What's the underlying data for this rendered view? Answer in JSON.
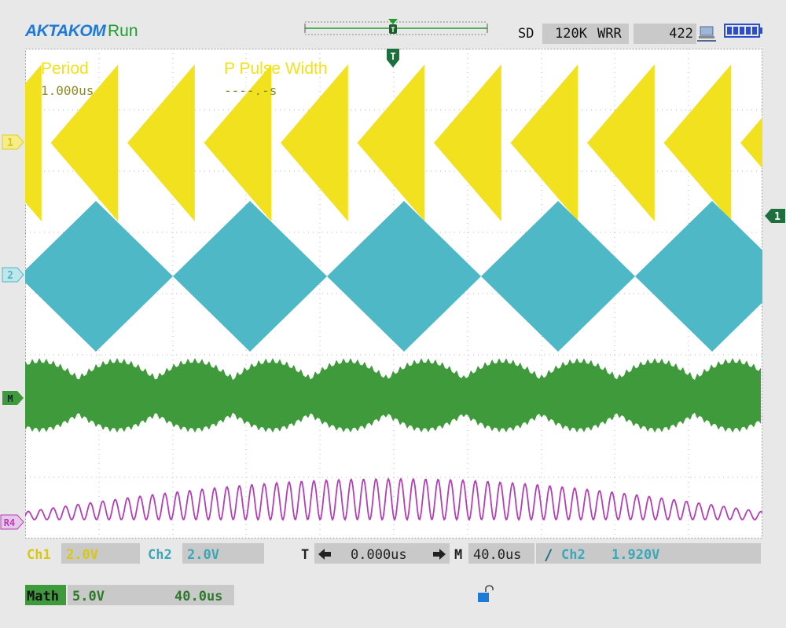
{
  "header": {
    "brand": "AKTAKOM",
    "run_state": "Run",
    "acq_mode": "SD",
    "memory_depth": "120K",
    "mode": "WRR",
    "acq_count": "422"
  },
  "icons": {
    "network": "network-icon",
    "battery": "battery-icon",
    "trigger_position": "trigger-t-icon",
    "lock": "lock-icon",
    "arrow_left": "arrow-left-icon",
    "arrow_right": "arrow-right-icon",
    "slope": "rising-edge-icon"
  },
  "markers": {
    "ch1": "1",
    "ch2": "2",
    "math": "M",
    "ref": "R4",
    "trigger_level": "1",
    "trigger": "T"
  },
  "measurements": [
    {
      "label": "Period",
      "value": "1.000us"
    },
    {
      "label": "P Pulse Width",
      "value": "----.-s"
    }
  ],
  "channels": {
    "ch1": {
      "label": "Ch1",
      "scale": "2.0V",
      "color": "#f1e11e"
    },
    "ch2": {
      "label": "Ch2",
      "scale": "2.0V",
      "color": "#4fb8c6"
    },
    "math": {
      "label": "Math",
      "scale": "5.0V",
      "timebase": "40.0us",
      "color": "#3f9a3c"
    },
    "ref": {
      "label": "R4",
      "color": "#b23fb5"
    }
  },
  "timebase": {
    "trigger_label": "T",
    "offset": "0.000us",
    "main_label": "M",
    "main": "40.0us"
  },
  "trigger": {
    "slope_symbol": "/",
    "source": "Ch2",
    "level": "1.920V"
  }
}
